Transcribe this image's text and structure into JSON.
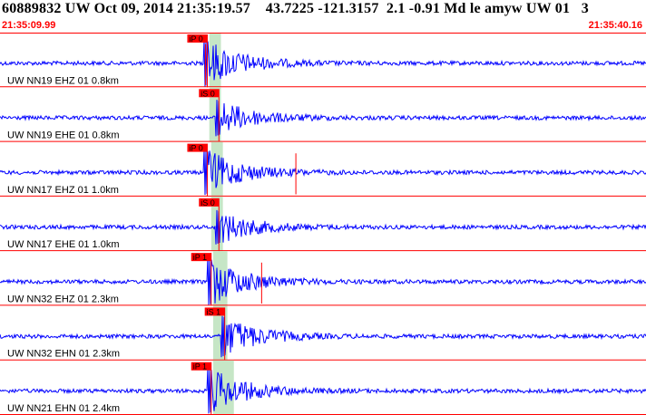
{
  "header": {
    "title": "60889832 UW Oct 09, 2014 21:35:19.57    43.7225 -121.3157  2.1 -0.91 Md le amyw UW 01   3",
    "start_time": "21:35:09.99",
    "end_time": "21:35:40.16"
  },
  "colors": {
    "trace": "#0000ff",
    "pick": "#ff0000",
    "window": "#c6e6c6",
    "separator": "#ff0000",
    "label_text": "#000000"
  },
  "channels": [
    {
      "label": "UW NN19 EHZ 01 0.8km",
      "pick": "iP 0",
      "pick_frac": 0.304,
      "sub_pick_frac": 0.318,
      "window_frac": [
        0.324,
        0.342
      ],
      "amp": 1.0
    },
    {
      "label": "UW NN19 EHE 01 0.8km",
      "pick": "iS 0",
      "pick_frac": 0.322,
      "sub_pick_frac": null,
      "window_frac": [
        0.324,
        0.342
      ],
      "amp": 0.75
    },
    {
      "label": "UW NN17 EHZ 01 1.0km",
      "pick": "iP 0",
      "pick_frac": 0.304,
      "sub_pick_frac": 0.458,
      "window_frac": [
        0.327,
        0.345
      ],
      "amp": 0.95
    },
    {
      "label": "UW NN17 EHE 01 1.0km",
      "pick": "iS 0",
      "pick_frac": 0.322,
      "sub_pick_frac": null,
      "window_frac": [
        0.327,
        0.345
      ],
      "amp": 0.7
    },
    {
      "label": "UW NN32 EHZ 01 2.3km",
      "pick": "iP 1",
      "pick_frac": 0.31,
      "sub_pick_frac": 0.405,
      "window_frac": [
        0.33,
        0.352
      ],
      "amp": 1.0
    },
    {
      "label": "UW NN32 EHN 01 2.3km",
      "pick": "iS 1",
      "pick_frac": 0.331,
      "sub_pick_frac": null,
      "window_frac": [
        0.33,
        0.352
      ],
      "amp": 0.85
    },
    {
      "label": "UW NN21 EHN 01 2.4km",
      "pick": "iP 1",
      "pick_frac": 0.31,
      "sub_pick_frac": null,
      "window_frac": [
        0.33,
        0.362
      ],
      "amp": 0.95
    }
  ]
}
